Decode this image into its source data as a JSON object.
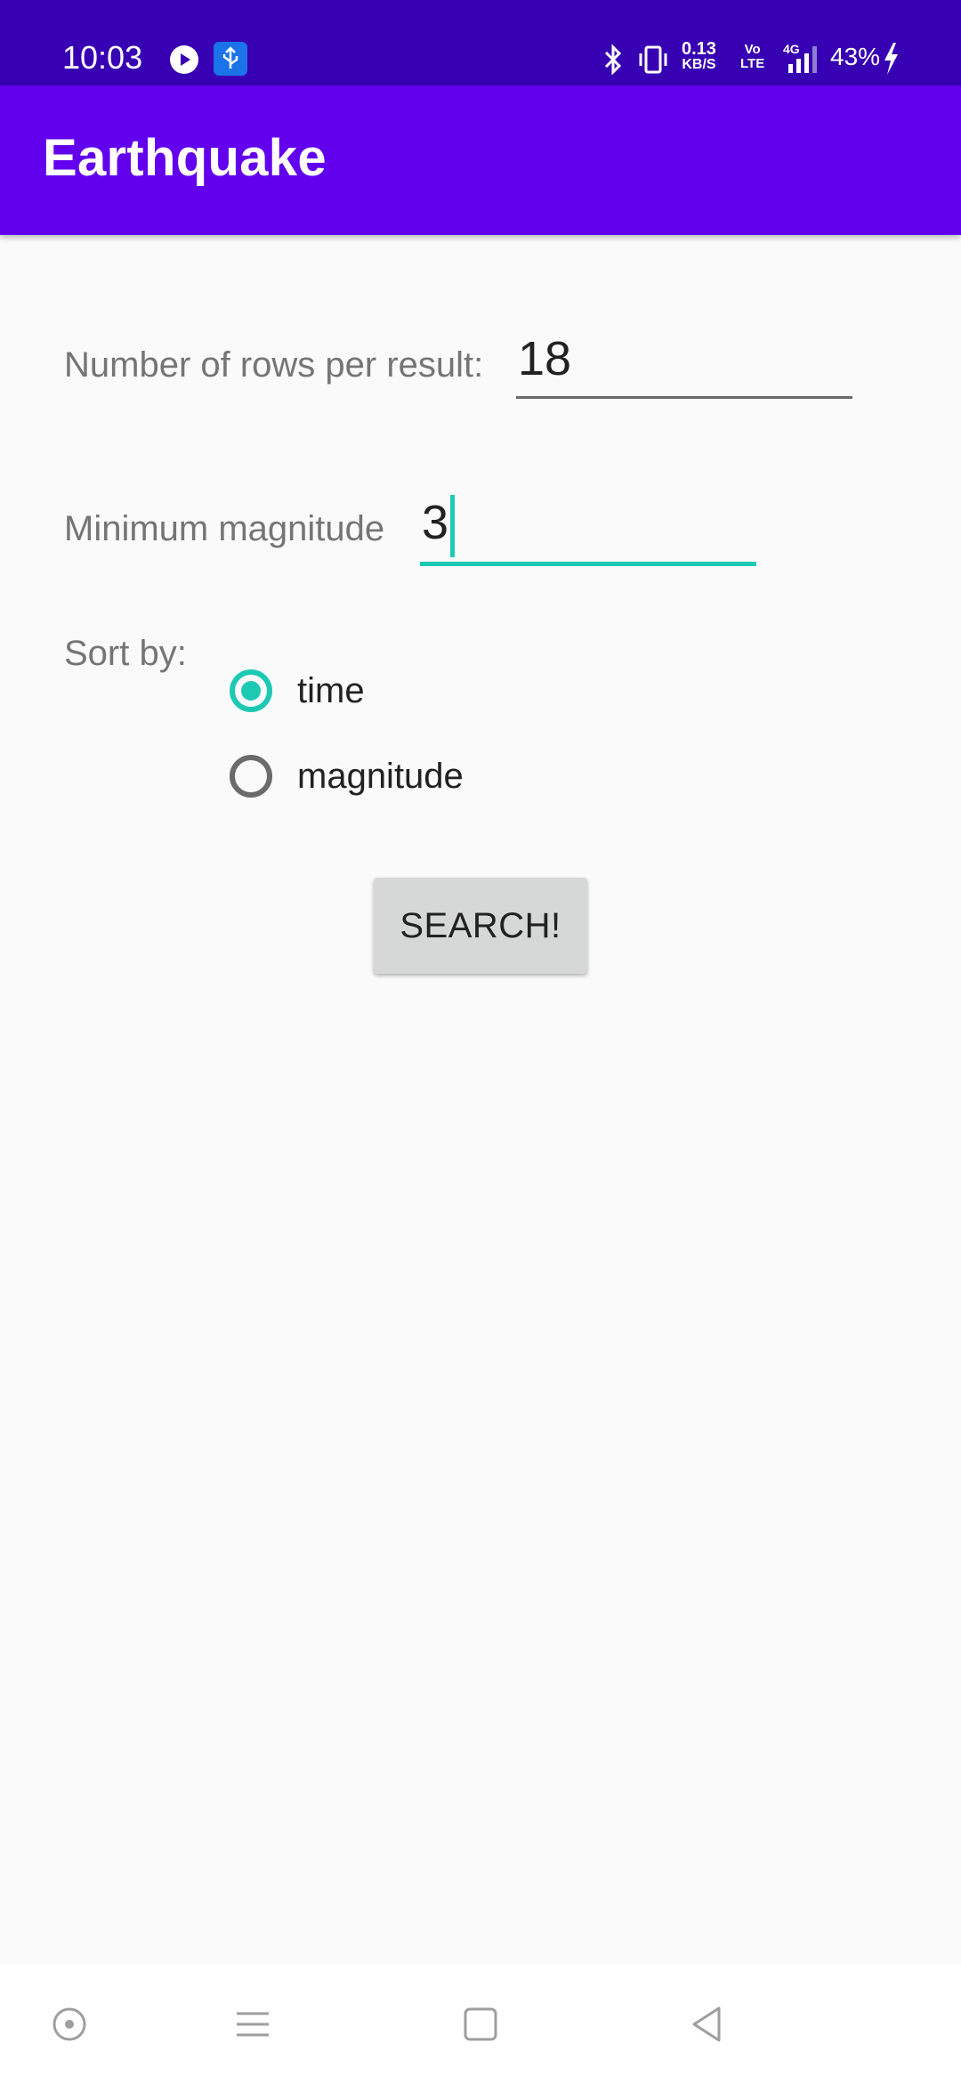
{
  "status_bar": {
    "time": "10:03",
    "speed_value": "0.13",
    "speed_unit": "KB/S",
    "volte_top": "Vo",
    "volte_bottom": "LTE",
    "network": "4G",
    "battery": "43%"
  },
  "toolbar": {
    "title": "Earthquake"
  },
  "form": {
    "rows_label": "Number of rows per result:",
    "rows_value": "18",
    "magnitude_label": "Minimum magnitude",
    "magnitude_value": "3",
    "sort_label": "Sort by:",
    "sort_options": [
      {
        "label": "time",
        "checked": true
      },
      {
        "label": "magnitude",
        "checked": false
      }
    ],
    "search_button": "SEARCH!"
  },
  "colors": {
    "status_bar": "#3700b3",
    "toolbar": "#6200ee",
    "accent": "#1ec9b4",
    "background": "#fafafa"
  },
  "nav_bar": {
    "icons": [
      "assistant-icon",
      "menu-icon",
      "home-icon",
      "back-icon"
    ]
  }
}
